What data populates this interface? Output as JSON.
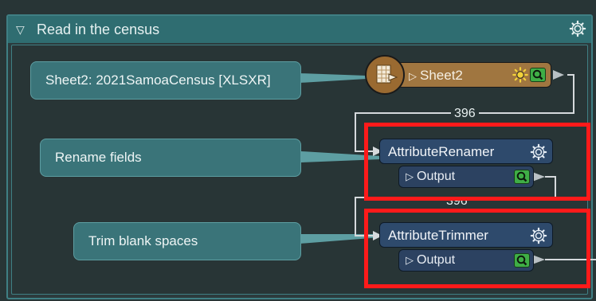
{
  "bookmark": {
    "title": "Read in the census"
  },
  "annotations": {
    "sheet": "Sheet2: 2021SamoaCensus [XLSXR]",
    "rename": "Rename fields",
    "trim": "Trim blank spaces"
  },
  "reader": {
    "label": "Sheet2"
  },
  "transformers": {
    "renamer": {
      "title": "AttributeRenamer",
      "port": "Output"
    },
    "trimmer": {
      "title": "AttributeTrimmer",
      "port": "Output"
    }
  },
  "connections": {
    "count_1": "396",
    "count_2": "396"
  },
  "colors": {
    "highlight": "#ff1a1a",
    "reader": "#a07640",
    "transformer": "#2e4a6c",
    "bookmark": "#2f6d71"
  }
}
